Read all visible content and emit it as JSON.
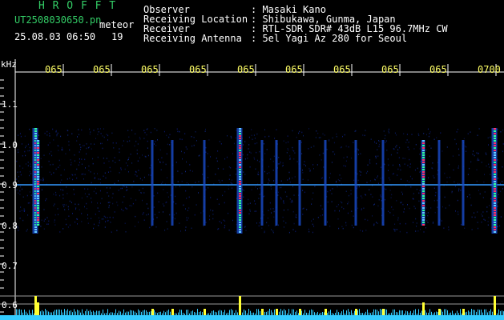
{
  "header": {
    "brand": "H R O F F T",
    "file_name": "UT2508030650.pn",
    "meteor_label": "meteor",
    "timestamp": "25.08.03 06:50",
    "meteor_count": "19",
    "fields": [
      {
        "label": "Observer",
        "value": ": Masaki Kano"
      },
      {
        "label": "Receiving Location",
        "value": ": Shibukawa, Gunma, Japan"
      },
      {
        "label": "Receiver",
        "value": ": RTL-SDR SDR# 43dB L15 96.7MHz CW"
      },
      {
        "label": "Receiving Antenna",
        "value": ": 5el Yagi Az 280 for Seoul"
      }
    ]
  },
  "axis": {
    "unit": "kHz",
    "y_labels": [
      "1.1",
      "1.0",
      "0.9",
      "0.8",
      "0.7",
      "0.6"
    ],
    "x_labels": [
      "065",
      "065",
      "065",
      "065",
      "065",
      "065",
      "065",
      "065",
      "065",
      "0700"
    ]
  },
  "colors": {
    "background": "#000000",
    "header_text": "#ffffff",
    "time_labels": "#ffff66",
    "brand": "#33cc66",
    "carrier": "#3399ff",
    "strong_echo": "#ff3366",
    "counter_bars": "#ffff33",
    "counter_baseline": "#33ccff"
  }
}
